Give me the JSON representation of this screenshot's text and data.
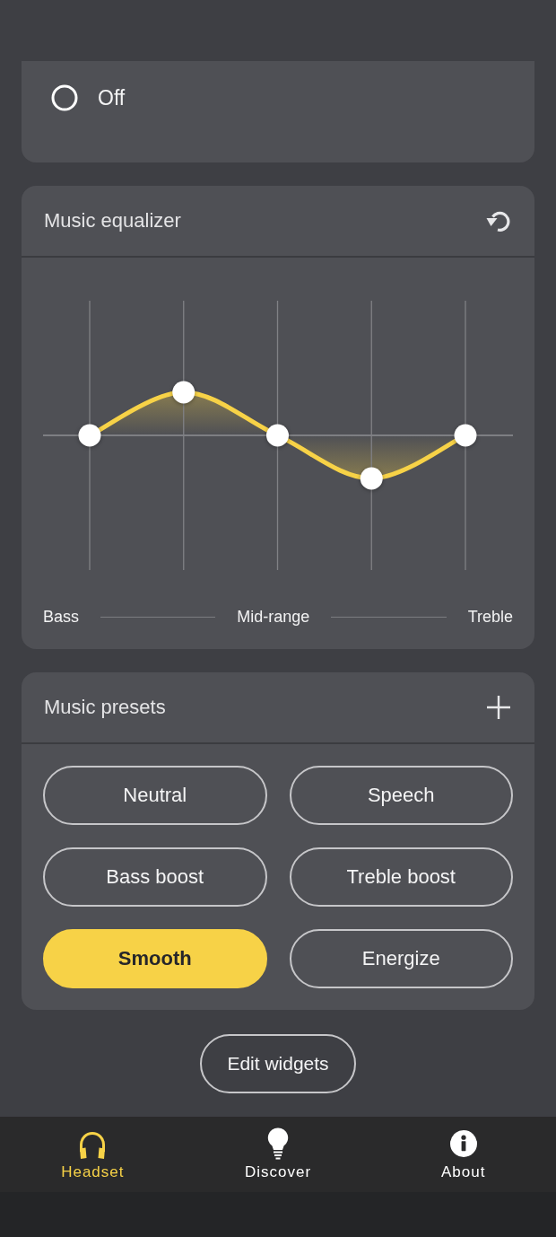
{
  "mode": {
    "options": [
      {
        "label": "Off",
        "selected": false
      }
    ]
  },
  "equalizer": {
    "title": "Music equalizer",
    "bands": [
      {
        "level": 0.5
      },
      {
        "level": 0.66
      },
      {
        "level": 0.5
      },
      {
        "level": 0.34
      },
      {
        "level": 0.5
      }
    ],
    "range_labels": [
      "Bass",
      "Mid-range",
      "Treble"
    ]
  },
  "presets": {
    "title": "Music presets",
    "items": [
      {
        "label": "Neutral",
        "selected": false
      },
      {
        "label": "Speech",
        "selected": false
      },
      {
        "label": "Bass boost",
        "selected": false
      },
      {
        "label": "Treble boost",
        "selected": false
      },
      {
        "label": "Smooth",
        "selected": true
      },
      {
        "label": "Energize",
        "selected": false
      }
    ]
  },
  "edit_button": {
    "label": "Edit widgets"
  },
  "bottom_nav": [
    {
      "label": "Headset",
      "selected": true
    },
    {
      "label": "Discover",
      "selected": false
    },
    {
      "label": "About",
      "selected": false
    }
  ]
}
